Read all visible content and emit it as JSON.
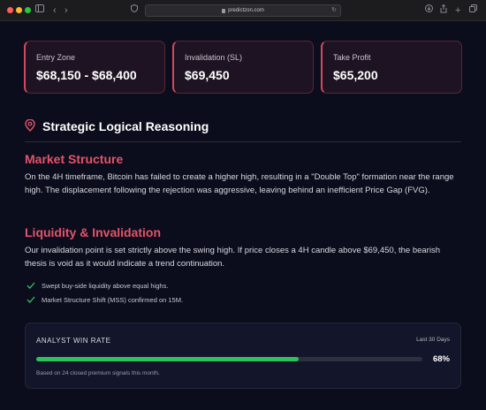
{
  "browser": {
    "url": "predictzon.com"
  },
  "cards": [
    {
      "label": "Entry Zone",
      "value": "$68,150 - $68,400"
    },
    {
      "label": "Invalidation (SL)",
      "value": "$69,450"
    },
    {
      "label": "Take Profit",
      "value": "$65,200"
    }
  ],
  "reasoning": {
    "title": "Strategic Logical Reasoning",
    "market_structure": {
      "heading": "Market Structure",
      "body": "On the 4H timeframe, Bitcoin has failed to create a higher high, resulting in a \"Double Top\" formation near the range high. The displacement following the rejection was aggressive, leaving behind an inefficient Price Gap (FVG)."
    },
    "liquidity": {
      "heading": "Liquidity & Invalidation",
      "body": "Our invalidation point is set strictly above the swing high. If price closes a 4H candle above $69,450, the bearish thesis is void as it would indicate a trend continuation."
    },
    "checks": [
      "Swept buy-side liquidity above equal highs.",
      "Market Structure Shift (MSS) confirmed on 15M."
    ]
  },
  "win_rate": {
    "title": "ANALYST WIN RATE",
    "period": "Last 30 Days",
    "percent_label": "68%",
    "percent_value": 68,
    "note": "Based on 24 closed premium signals this month."
  },
  "colors": {
    "accent": "#e5536a",
    "success": "#2fc25b",
    "background": "#0b0d1c"
  }
}
